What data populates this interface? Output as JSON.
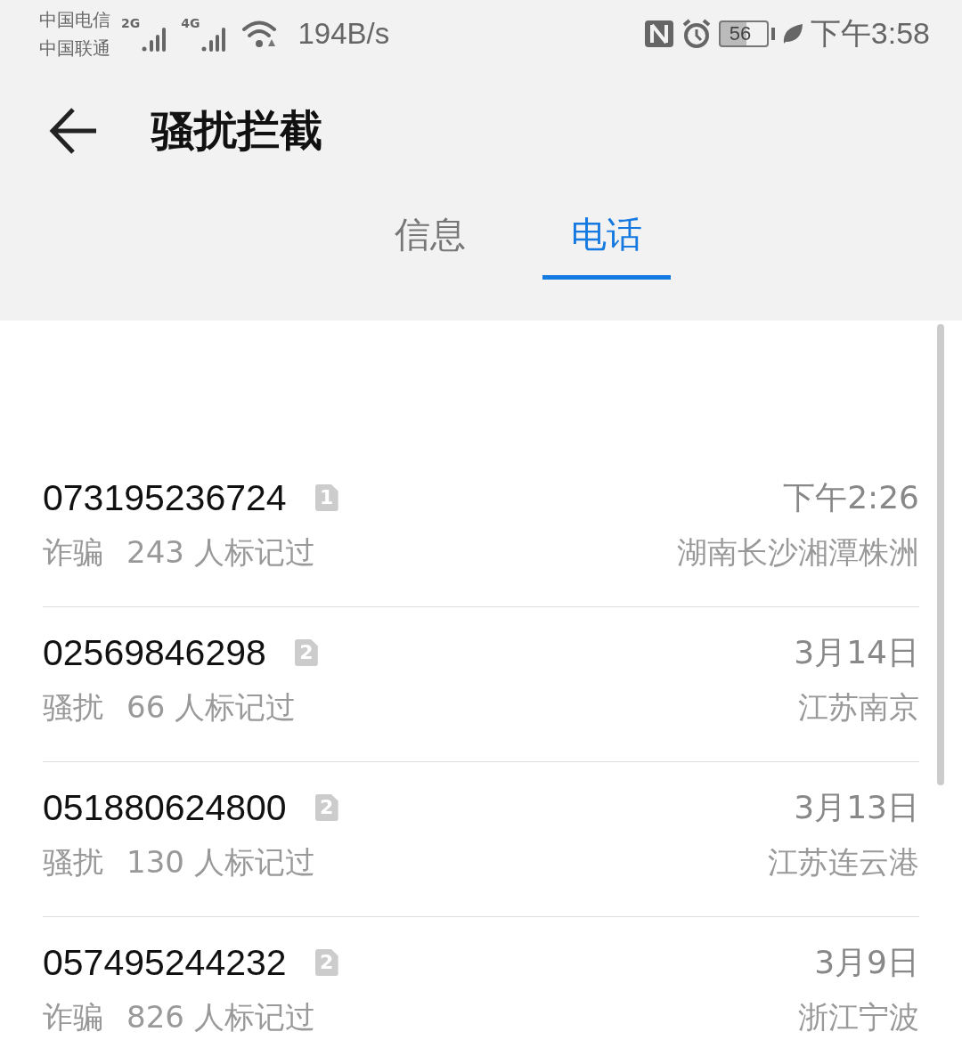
{
  "status_bar": {
    "carriers": [
      "中国电信",
      "中国联通"
    ],
    "net_labels": [
      "2G",
      "4G"
    ],
    "speed": "194B/s",
    "battery": "56",
    "time": "下午3:58"
  },
  "title": "骚扰拦截",
  "tabs": [
    {
      "label": "信息",
      "selected": false
    },
    {
      "label": "电话",
      "selected": true
    }
  ],
  "calls": [
    {
      "number": "073195236724",
      "sim": "1",
      "tag": "诈骗",
      "count": "243 人标记过",
      "time": "下午2:26",
      "location": "湖南长沙湘潭株洲"
    },
    {
      "number": "02569846298",
      "sim": "2",
      "tag": "骚扰",
      "count": "66 人标记过",
      "time": "3月14日",
      "location": "江苏南京"
    },
    {
      "number": "051880624800",
      "sim": "2",
      "tag": "骚扰",
      "count": "130 人标记过",
      "time": "3月13日",
      "location": "江苏连云港"
    },
    {
      "number": "057495244232",
      "sim": "2",
      "tag": "诈骗",
      "count": "826 人标记过",
      "time": "3月9日",
      "location": "浙江宁波"
    }
  ]
}
